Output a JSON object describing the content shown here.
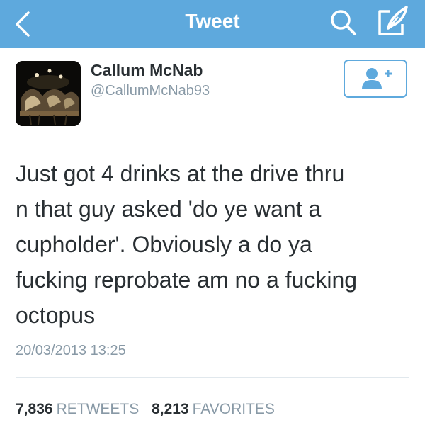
{
  "nav": {
    "title": "Tweet",
    "back_icon": "chevron-left-icon",
    "search_icon": "search-icon",
    "compose_icon": "compose-icon",
    "bar_color": "#5ea9dd"
  },
  "author": {
    "display_name": "Callum McNab",
    "screen_name": "@CallumMcNab93",
    "follow_icon": "add-user-icon"
  },
  "tweet": {
    "text": "Just got 4 drinks at the drive thru\nn that guy asked 'do ye want a\ncupholder'. Obviously a do ya\nfucking reprobate am no a fucking\noctopus",
    "timestamp": "20/03/2013 13:25"
  },
  "stats": {
    "retweets_count": "7,836",
    "retweets_label": "RETWEETS",
    "favorites_count": "8,213",
    "favorites_label": "FAVORITES"
  },
  "colors": {
    "accent": "#5ea9dd",
    "text": "#292f33",
    "muted": "#8899a6"
  }
}
